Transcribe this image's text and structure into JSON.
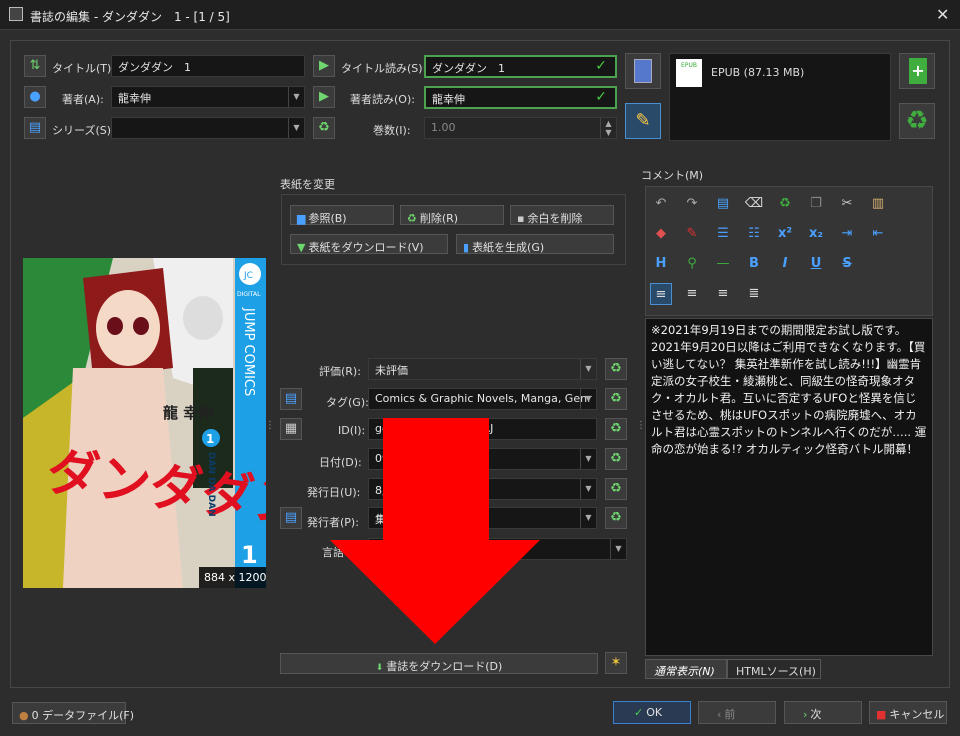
{
  "window": {
    "title": "書誌の編集 - ダンダダン　1 - [1 / 5]"
  },
  "fields": {
    "title_label": "タイトル(T):",
    "title_value": "ダンダダン　1",
    "title_reading_label": "タイトル読み(S):",
    "title_reading_value": "ダンダダン　1",
    "author_label": "著者(A):",
    "author_value": "龍幸伸",
    "author_reading_label": "著者読み(O):",
    "author_reading_value": "龍幸伸",
    "series_label": "シリーズ(S):",
    "series_value": "",
    "volume_label": "巻数(I):",
    "volume_value": "1.00"
  },
  "format": {
    "label": "EPUB (87.13 MB)",
    "icon_text": "EPUB"
  },
  "cover_section": {
    "heading": "表紙を変更",
    "browse": "参照(B)",
    "delete": "削除(R)",
    "trim": "余白を削除",
    "download": "表紙をダウンロード(V)",
    "generate": "表紙を生成(G)",
    "size": "884 x 1200"
  },
  "cover_art": {
    "brand": "JUMP COMICS",
    "digital": "DIGITAL",
    "author": "龍 幸伸",
    "title_art": "ダンダダン",
    "romaji": "DAN DA DAN",
    "volume": "1"
  },
  "meta": {
    "rating_label": "評価(R):",
    "rating_value": "未評価",
    "tags_label": "タグ(G):",
    "tags_value": "Comics & Graphic Novels, Manga, Genr",
    "id_label": "ID(I):",
    "id_value": "google:TvKEAAAQBAJ",
    "date_label": "日付(D):",
    "date_value": "09",
    "pubdate_label": "発行日(U):",
    "pubdate_value": "8月",
    "publisher_label": "発行者(P):",
    "publisher_value": "集",
    "language_label": "言語"
  },
  "download_metadata": "書誌をダウンロード(D)",
  "comment": {
    "label": "コメント(M)",
    "text": "※2021年9月19日までの期間限定お試し版です。2021年9月20日以降はご利用できなくなります。【買い逃してない？ 集英社準新作を試し読み!!!】幽霊肯定派の女子校生・綾瀬桃と、同級生の怪奇現象オタク・オカルト君。互いに否定するUFOと怪異を信じさせるため、桃はUFOスポットの病院廃墟へ、オカルト君は心霊スポットのトンネルへ行くのだが….. 運命の恋が始まる!? オカルティック怪奇バトル開幕！",
    "tab_normal": "通常表示(N)",
    "tab_html": "HTMLソース(H)"
  },
  "footer": {
    "data_files": "0 データファイル(F)",
    "ok": "OK",
    "prev": "前",
    "next": "次",
    "cancel": "キャンセル"
  },
  "colors": {
    "accent_green": "#4da34d",
    "arrow_red": "#ff0000",
    "cover_blue": "#1ea0e6"
  }
}
